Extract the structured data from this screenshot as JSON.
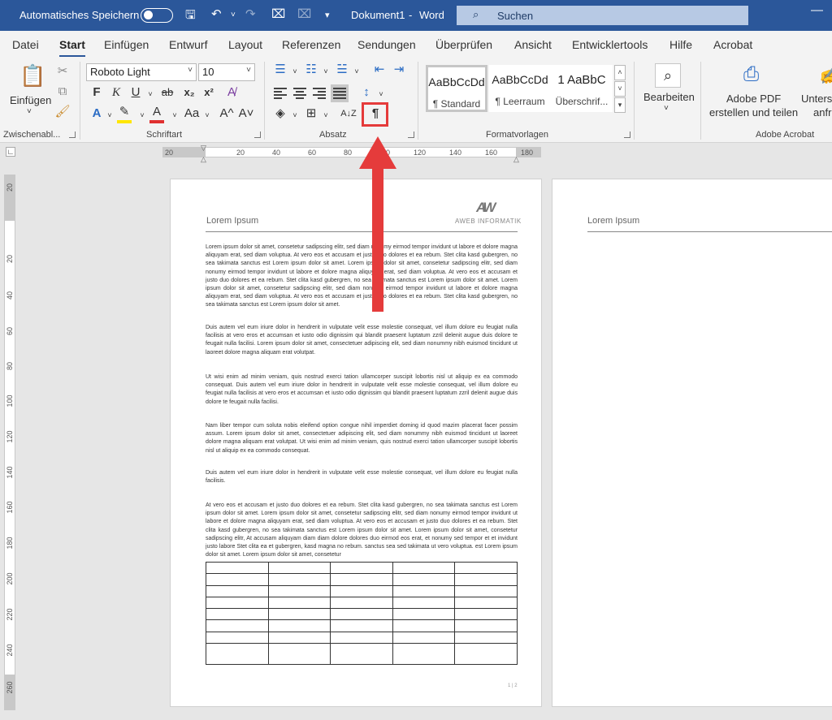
{
  "titlebar": {
    "autosave_label": "Automatisches Speichern",
    "doc_name": "Dokument1",
    "separator": "-",
    "app_name": "Word",
    "search_placeholder": "Suchen"
  },
  "menu": {
    "tabs": [
      "Datei",
      "Start",
      "Einfügen",
      "Entwurf",
      "Layout",
      "Referenzen",
      "Sendungen",
      "Überprüfen",
      "Ansicht",
      "Entwicklertools",
      "Hilfe",
      "Acrobat"
    ],
    "active": "Start"
  },
  "ribbon": {
    "clipboard": {
      "paste_label": "Einfügen",
      "group_label": "Zwischenabl..."
    },
    "font": {
      "font_name": "Roboto Light",
      "font_size": "10",
      "group_label": "Schriftart",
      "bold": "F",
      "italic": "K",
      "underline": "U",
      "strike": "ab",
      "subscript": "x₂",
      "superscript": "x²",
      "case": "Aa",
      "grow": "A^",
      "shrink": "A˅",
      "text_effects": "A",
      "font_color": "A"
    },
    "paragraph": {
      "group_label": "Absatz",
      "sort": "A↓Z",
      "show_marks": "¶"
    },
    "styles": {
      "group_label": "Formatvorlagen",
      "items": [
        {
          "preview": "AaBbCcDd",
          "name": "¶ Standard"
        },
        {
          "preview": "AaBbCcDd",
          "name": "¶ Leerraum"
        },
        {
          "preview": "1  AaBbC",
          "name": "Überschrif..."
        }
      ]
    },
    "editing": {
      "label": "Bearbeiten"
    },
    "acrobat": {
      "pdf_label_1": "Adobe PDF",
      "pdf_label_2": "erstellen und teilen",
      "sign_label_1": "Unters",
      "sign_label_2": "anfr",
      "group_label": "Adobe Acrobat"
    }
  },
  "ruler": {
    "h_labels": [
      "20",
      "20",
      "40",
      "60",
      "80",
      "100",
      "120",
      "140",
      "160",
      "180"
    ],
    "v_labels": [
      "20",
      "20",
      "40",
      "60",
      "80",
      "100",
      "120",
      "140",
      "160",
      "180",
      "200",
      "220",
      "240",
      "260"
    ]
  },
  "document": {
    "header_title": "Lorem Ipsum",
    "logo_mark": "AW",
    "logo_text": "AWEB INFORMATIK",
    "paragraphs": [
      "Lorem ipsum dolor sit amet, consetetur sadipscing elitr, sed diam nonumy eirmod tempor invidunt ut labore et dolore magna aliquyam erat, sed diam voluptua. At vero eos et accusam et justo duo dolores et ea rebum. Stet clita kasd gubergren, no sea takimata sanctus est Lorem ipsum dolor sit amet. Lorem ipsum dolor sit amet, consetetur sadipscing elitr, sed diam nonumy eirmod tempor invidunt ut labore et dolore magna aliquyam erat, sed diam voluptua. At vero eos et accusam et justo duo dolores et ea rebum. Stet clita kasd gubergren, no sea takimata sanctus est Lorem ipsum dolor sit amet. Lorem ipsum dolor sit amet, consetetur sadipscing elitr, sed diam nonumy eirmod tempor invidunt ut labore et dolore magna aliquyam erat, sed diam voluptua. At vero eos et accusam et justo duo dolores et ea rebum. Stet clita kasd gubergren, no sea takimata sanctus est Lorem ipsum dolor sit amet.",
      "Duis autem vel eum iriure dolor in hendrerit in vulputate velit esse molestie consequat, vel illum dolore eu feugiat nulla facilisis at vero eros et accumsan et iusto odio dignissim qui blandit praesent luptatum zzril delenit augue duis dolore te feugait nulla facilisi. Lorem ipsum dolor sit amet, consectetuer adipiscing elit, sed diam nonummy nibh euismod tincidunt ut laoreet dolore magna aliquam erat volutpat.",
      "Ut wisi enim ad minim veniam, quis nostrud exerci tation ullamcorper suscipit lobortis nisl ut aliquip ex ea commodo consequat. Duis autem vel eum iriure dolor in hendrerit in vulputate velit esse molestie consequat, vel illum dolore eu feugiat nulla facilisis at vero eros et accumsan et iusto odio dignissim qui blandit praesent luptatum zzril delenit augue duis dolore te feugait nulla facilisi.",
      "Nam liber tempor cum soluta nobis eleifend option congue nihil imperdiet doming id quod mazim placerat facer possim assum. Lorem ipsum dolor sit amet, consectetuer adipiscing elit, sed diam nonummy nibh euismod tincidunt ut laoreet dolore magna aliquam erat volutpat. Ut wisi enim ad minim veniam, quis nostrud exerci tation ullamcorper suscipit lobortis nisl ut aliquip ex ea commodo consequat.",
      "Duis autem vel eum iriure dolor in hendrerit in vulputate velit esse molestie consequat, vel illum dolore eu feugiat nulla facilisis.",
      "At vero eos et accusam et justo duo dolores et ea rebum. Stet clita kasd gubergren, no sea takimata sanctus est Lorem ipsum dolor sit amet. Lorem ipsum dolor sit amet, consetetur sadipscing elitr, sed diam nonumy eirmod tempor invidunt ut labore et dolore magna aliquyam erat, sed diam voluptua. At vero eos et accusam et justo duo dolores et ea rebum. Stet clita kasd gubergren, no sea takimata sanctus est Lorem ipsum dolor sit amet. Lorem ipsum dolor sit amet, consetetur sadipscing elitr, At accusam aliquyam diam diam dolore dolores duo eirmod eos erat, et nonumy sed tempor et et invidunt justo labore Stet clita ea et gubergren, kasd magna no rebum. sanctus sea sed takimata ut vero voluptua. est Lorem ipsum dolor sit amet. Lorem ipsum dolor sit amet, consetetur"
    ],
    "page_number": "1 | 2",
    "page2_header_title": "Lorem Ipsum"
  },
  "colors": {
    "titlebar": "#2b579a",
    "highlight": "#e53b3b"
  }
}
